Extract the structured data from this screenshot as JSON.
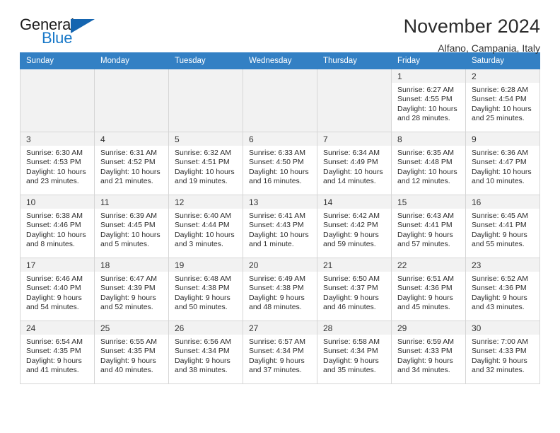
{
  "brand": {
    "name_part1": "General",
    "name_part2": "Blue",
    "accent_color": "#1878c8",
    "triangle_color": "#1565b0"
  },
  "header": {
    "title": "November 2024",
    "subtitle": "Alfano, Campania, Italy"
  },
  "calendar": {
    "header_bg": "#3380c4",
    "weekday_headers": [
      "Sunday",
      "Monday",
      "Tuesday",
      "Wednesday",
      "Thursday",
      "Friday",
      "Saturday"
    ],
    "labels": {
      "sunrise": "Sunrise:",
      "sunset": "Sunset:",
      "daylight": "Daylight:"
    },
    "weeks": [
      [
        {
          "day": "",
          "sunrise": "",
          "sunset": "",
          "daylight": "",
          "empty": true
        },
        {
          "day": "",
          "sunrise": "",
          "sunset": "",
          "daylight": "",
          "empty": true
        },
        {
          "day": "",
          "sunrise": "",
          "sunset": "",
          "daylight": "",
          "empty": true
        },
        {
          "day": "",
          "sunrise": "",
          "sunset": "",
          "daylight": "",
          "empty": true
        },
        {
          "day": "",
          "sunrise": "",
          "sunset": "",
          "daylight": "",
          "empty": true
        },
        {
          "day": "1",
          "sunrise": "Sunrise: 6:27 AM",
          "sunset": "Sunset: 4:55 PM",
          "daylight": "Daylight: 10 hours and 28 minutes.",
          "empty": false
        },
        {
          "day": "2",
          "sunrise": "Sunrise: 6:28 AM",
          "sunset": "Sunset: 4:54 PM",
          "daylight": "Daylight: 10 hours and 25 minutes.",
          "empty": false
        }
      ],
      [
        {
          "day": "3",
          "sunrise": "Sunrise: 6:30 AM",
          "sunset": "Sunset: 4:53 PM",
          "daylight": "Daylight: 10 hours and 23 minutes.",
          "empty": false
        },
        {
          "day": "4",
          "sunrise": "Sunrise: 6:31 AM",
          "sunset": "Sunset: 4:52 PM",
          "daylight": "Daylight: 10 hours and 21 minutes.",
          "empty": false
        },
        {
          "day": "5",
          "sunrise": "Sunrise: 6:32 AM",
          "sunset": "Sunset: 4:51 PM",
          "daylight": "Daylight: 10 hours and 19 minutes.",
          "empty": false
        },
        {
          "day": "6",
          "sunrise": "Sunrise: 6:33 AM",
          "sunset": "Sunset: 4:50 PM",
          "daylight": "Daylight: 10 hours and 16 minutes.",
          "empty": false
        },
        {
          "day": "7",
          "sunrise": "Sunrise: 6:34 AM",
          "sunset": "Sunset: 4:49 PM",
          "daylight": "Daylight: 10 hours and 14 minutes.",
          "empty": false
        },
        {
          "day": "8",
          "sunrise": "Sunrise: 6:35 AM",
          "sunset": "Sunset: 4:48 PM",
          "daylight": "Daylight: 10 hours and 12 minutes.",
          "empty": false
        },
        {
          "day": "9",
          "sunrise": "Sunrise: 6:36 AM",
          "sunset": "Sunset: 4:47 PM",
          "daylight": "Daylight: 10 hours and 10 minutes.",
          "empty": false
        }
      ],
      [
        {
          "day": "10",
          "sunrise": "Sunrise: 6:38 AM",
          "sunset": "Sunset: 4:46 PM",
          "daylight": "Daylight: 10 hours and 8 minutes.",
          "empty": false
        },
        {
          "day": "11",
          "sunrise": "Sunrise: 6:39 AM",
          "sunset": "Sunset: 4:45 PM",
          "daylight": "Daylight: 10 hours and 5 minutes.",
          "empty": false
        },
        {
          "day": "12",
          "sunrise": "Sunrise: 6:40 AM",
          "sunset": "Sunset: 4:44 PM",
          "daylight": "Daylight: 10 hours and 3 minutes.",
          "empty": false
        },
        {
          "day": "13",
          "sunrise": "Sunrise: 6:41 AM",
          "sunset": "Sunset: 4:43 PM",
          "daylight": "Daylight: 10 hours and 1 minute.",
          "empty": false
        },
        {
          "day": "14",
          "sunrise": "Sunrise: 6:42 AM",
          "sunset": "Sunset: 4:42 PM",
          "daylight": "Daylight: 9 hours and 59 minutes.",
          "empty": false
        },
        {
          "day": "15",
          "sunrise": "Sunrise: 6:43 AM",
          "sunset": "Sunset: 4:41 PM",
          "daylight": "Daylight: 9 hours and 57 minutes.",
          "empty": false
        },
        {
          "day": "16",
          "sunrise": "Sunrise: 6:45 AM",
          "sunset": "Sunset: 4:41 PM",
          "daylight": "Daylight: 9 hours and 55 minutes.",
          "empty": false
        }
      ],
      [
        {
          "day": "17",
          "sunrise": "Sunrise: 6:46 AM",
          "sunset": "Sunset: 4:40 PM",
          "daylight": "Daylight: 9 hours and 54 minutes.",
          "empty": false
        },
        {
          "day": "18",
          "sunrise": "Sunrise: 6:47 AM",
          "sunset": "Sunset: 4:39 PM",
          "daylight": "Daylight: 9 hours and 52 minutes.",
          "empty": false
        },
        {
          "day": "19",
          "sunrise": "Sunrise: 6:48 AM",
          "sunset": "Sunset: 4:38 PM",
          "daylight": "Daylight: 9 hours and 50 minutes.",
          "empty": false
        },
        {
          "day": "20",
          "sunrise": "Sunrise: 6:49 AM",
          "sunset": "Sunset: 4:38 PM",
          "daylight": "Daylight: 9 hours and 48 minutes.",
          "empty": false
        },
        {
          "day": "21",
          "sunrise": "Sunrise: 6:50 AM",
          "sunset": "Sunset: 4:37 PM",
          "daylight": "Daylight: 9 hours and 46 minutes.",
          "empty": false
        },
        {
          "day": "22",
          "sunrise": "Sunrise: 6:51 AM",
          "sunset": "Sunset: 4:36 PM",
          "daylight": "Daylight: 9 hours and 45 minutes.",
          "empty": false
        },
        {
          "day": "23",
          "sunrise": "Sunrise: 6:52 AM",
          "sunset": "Sunset: 4:36 PM",
          "daylight": "Daylight: 9 hours and 43 minutes.",
          "empty": false
        }
      ],
      [
        {
          "day": "24",
          "sunrise": "Sunrise: 6:54 AM",
          "sunset": "Sunset: 4:35 PM",
          "daylight": "Daylight: 9 hours and 41 minutes.",
          "empty": false
        },
        {
          "day": "25",
          "sunrise": "Sunrise: 6:55 AM",
          "sunset": "Sunset: 4:35 PM",
          "daylight": "Daylight: 9 hours and 40 minutes.",
          "empty": false
        },
        {
          "day": "26",
          "sunrise": "Sunrise: 6:56 AM",
          "sunset": "Sunset: 4:34 PM",
          "daylight": "Daylight: 9 hours and 38 minutes.",
          "empty": false
        },
        {
          "day": "27",
          "sunrise": "Sunrise: 6:57 AM",
          "sunset": "Sunset: 4:34 PM",
          "daylight": "Daylight: 9 hours and 37 minutes.",
          "empty": false
        },
        {
          "day": "28",
          "sunrise": "Sunrise: 6:58 AM",
          "sunset": "Sunset: 4:34 PM",
          "daylight": "Daylight: 9 hours and 35 minutes.",
          "empty": false
        },
        {
          "day": "29",
          "sunrise": "Sunrise: 6:59 AM",
          "sunset": "Sunset: 4:33 PM",
          "daylight": "Daylight: 9 hours and 34 minutes.",
          "empty": false
        },
        {
          "day": "30",
          "sunrise": "Sunrise: 7:00 AM",
          "sunset": "Sunset: 4:33 PM",
          "daylight": "Daylight: 9 hours and 32 minutes.",
          "empty": false
        }
      ]
    ]
  }
}
